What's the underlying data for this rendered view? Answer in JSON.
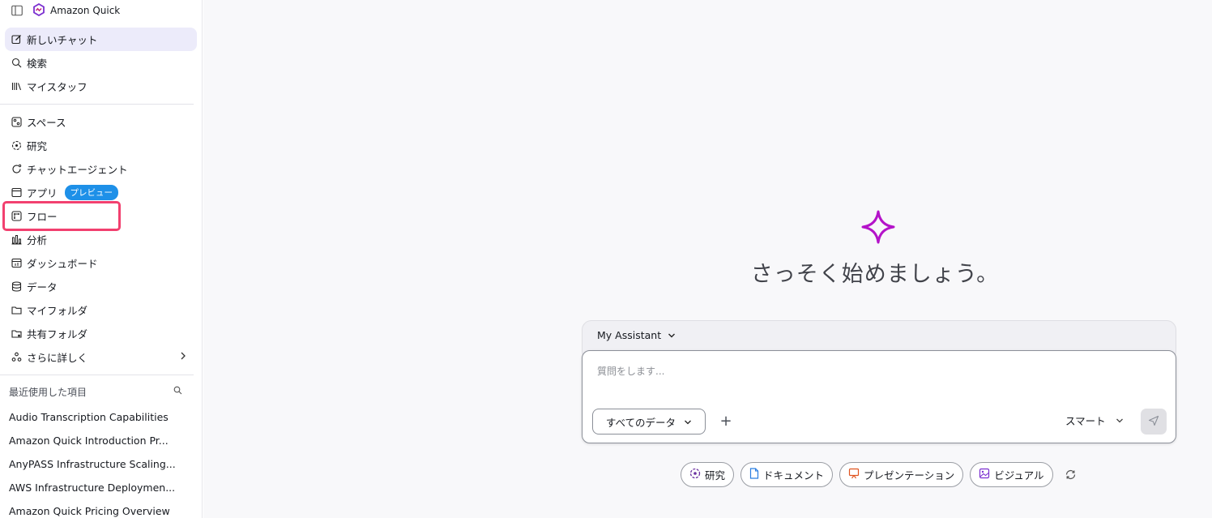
{
  "app": {
    "title": "Amazon Quick"
  },
  "sidebar": {
    "top_items": [
      {
        "label": "新しいチャット",
        "icon": "edit-icon"
      },
      {
        "label": "検索",
        "icon": "search-icon"
      },
      {
        "label": "マイスタッフ",
        "icon": "library-icon"
      }
    ],
    "items": [
      {
        "label": "スペース",
        "icon": "spaces-icon"
      },
      {
        "label": "研究",
        "icon": "research-icon"
      },
      {
        "label": "チャットエージェント",
        "icon": "chat-agent-icon"
      },
      {
        "label": "アプリ",
        "icon": "app-icon",
        "badge": "プレビュー"
      },
      {
        "label": "フロー",
        "icon": "flow-icon"
      },
      {
        "label": "分析",
        "icon": "analysis-icon"
      },
      {
        "label": "ダッシュボード",
        "icon": "dashboard-icon"
      },
      {
        "label": "データ",
        "icon": "database-icon"
      },
      {
        "label": "マイフォルダ",
        "icon": "folder-icon"
      },
      {
        "label": "共有フォルダ",
        "icon": "shared-folder-icon"
      },
      {
        "label": "さらに詳しく",
        "icon": "more-icon"
      }
    ],
    "recent": {
      "header": "最近使用した項目",
      "items": [
        "Audio Transcription Capabilities",
        "Amazon Quick Introduction Pr...",
        "AnyPASS Infrastructure Scaling...",
        "AWS Infrastructure Deploymen...",
        "Amazon Quick Pricing Overview"
      ]
    }
  },
  "main": {
    "headline": "さっそく始めましょう。",
    "assistant_label": "My Assistant",
    "composer": {
      "placeholder": "質問をします...",
      "data_source": "すべてのデータ",
      "plus": "+",
      "mode": "スマート"
    },
    "chips": [
      {
        "label": "研究",
        "icon": "research-icon"
      },
      {
        "label": "ドキュメント",
        "icon": "document-icon"
      },
      {
        "label": "プレゼンテーション",
        "icon": "presentation-icon"
      },
      {
        "label": "ビジュアル",
        "icon": "visual-icon"
      }
    ]
  },
  "colors": {
    "accent": "#7b2fd0",
    "sparkle": "#b413c9",
    "badge": "#1e90e8",
    "highlight": "#f2406f",
    "active_bg": "#ecebfa"
  }
}
